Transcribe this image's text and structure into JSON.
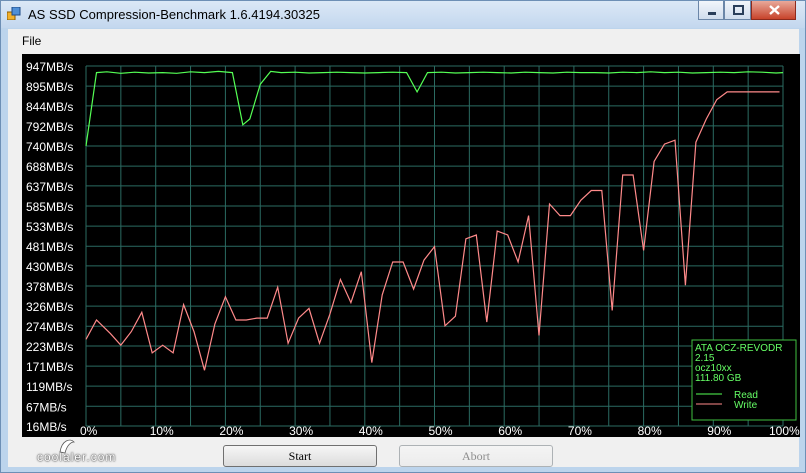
{
  "window": {
    "title": "AS SSD Compression-Benchmark 1.6.4194.30325"
  },
  "menu": {
    "file": "File"
  },
  "buttons": {
    "start": "Start",
    "abort": "Abort"
  },
  "watermark": "coolaler.com",
  "colors": {
    "read": "#55ff55",
    "write": "#ff8a8a",
    "grid": "#2b6b62",
    "axis_text": "#ffffff",
    "info_text": "#66ff66"
  },
  "drive_info": {
    "model": "ATA OCZ-REVODR",
    "firmware": "2.15",
    "driver": "ocz10xx",
    "capacity": "111.80 GB",
    "legend_read": "Read",
    "legend_write": "Write"
  },
  "chart_data": {
    "type": "line",
    "title": "",
    "xlabel": "",
    "ylabel": "",
    "y_tick_labels": [
      "947MB/s",
      "895MB/s",
      "844MB/s",
      "792MB/s",
      "740MB/s",
      "688MB/s",
      "637MB/s",
      "585MB/s",
      "533MB/s",
      "481MB/s",
      "430MB/s",
      "378MB/s",
      "326MB/s",
      "274MB/s",
      "223MB/s",
      "171MB/s",
      "119MB/s",
      "67MB/s",
      "16MB/s"
    ],
    "y_tick_values": [
      947,
      895,
      844,
      792,
      740,
      688,
      637,
      585,
      533,
      481,
      430,
      378,
      326,
      274,
      223,
      171,
      119,
      67,
      16
    ],
    "x_tick_labels": [
      "0%",
      "10%",
      "20%",
      "30%",
      "40%",
      "50%",
      "60%",
      "70%",
      "80%",
      "90%",
      "100%"
    ],
    "x_tick_values": [
      0,
      10,
      20,
      30,
      40,
      50,
      60,
      70,
      80,
      90,
      100
    ],
    "xlim": [
      0,
      100
    ],
    "ylim": [
      16,
      947
    ],
    "grid": true,
    "legend": "bottom-right",
    "series": [
      {
        "name": "Read",
        "x": [
          0,
          1.5,
          3,
          5,
          7,
          9,
          11,
          13,
          15,
          17,
          19,
          21,
          22.5,
          23.5,
          25,
          26.5,
          28,
          30,
          32,
          34,
          36,
          38,
          40,
          42,
          44,
          46,
          47.5,
          49,
          51,
          53,
          55,
          57,
          59,
          61,
          63,
          65,
          67,
          69,
          71,
          73,
          75,
          77,
          79,
          81,
          83,
          85,
          87,
          89,
          91,
          93,
          95,
          97,
          99,
          100
        ],
        "y": [
          740,
          930,
          932,
          928,
          931,
          929,
          930,
          928,
          932,
          930,
          933,
          930,
          795,
          810,
          900,
          933,
          930,
          931,
          929,
          930,
          931,
          930,
          929,
          930,
          931,
          930,
          880,
          930,
          931,
          929,
          930,
          931,
          930,
          929,
          931,
          930,
          929,
          931,
          930,
          930,
          929,
          931,
          930,
          932,
          930,
          931,
          929,
          930,
          931,
          930,
          932,
          931,
          929,
          930
        ]
      },
      {
        "name": "Write",
        "x": [
          0,
          1.5,
          3.5,
          5,
          6.5,
          8,
          9.5,
          11,
          12.5,
          14,
          15.5,
          17,
          18.5,
          20,
          21.5,
          23,
          24.5,
          26,
          27.5,
          29,
          30.5,
          32,
          33.5,
          35,
          36.5,
          38,
          39.5,
          41,
          42.5,
          44,
          45.5,
          47,
          48.5,
          50,
          51.5,
          53,
          54.5,
          56,
          57.5,
          59,
          60.5,
          62,
          63.5,
          65,
          66.5,
          68,
          69.5,
          71,
          72.5,
          74,
          75.5,
          77,
          78.5,
          80,
          81.5,
          83,
          84.5,
          86,
          87.5,
          89,
          90.5,
          92,
          93.5,
          95,
          96.5,
          98,
          99.5
        ],
        "y": [
          240,
          290,
          255,
          225,
          260,
          310,
          205,
          225,
          205,
          330,
          260,
          160,
          280,
          350,
          290,
          290,
          295,
          295,
          375,
          230,
          295,
          320,
          230,
          305,
          395,
          335,
          415,
          180,
          355,
          440,
          440,
          370,
          445,
          480,
          275,
          300,
          500,
          510,
          285,
          520,
          510,
          440,
          560,
          250,
          590,
          560,
          560,
          600,
          625,
          625,
          315,
          665,
          665,
          470,
          700,
          745,
          755,
          380,
          750,
          810,
          860,
          880,
          880,
          880,
          880,
          880,
          880
        ]
      }
    ]
  }
}
